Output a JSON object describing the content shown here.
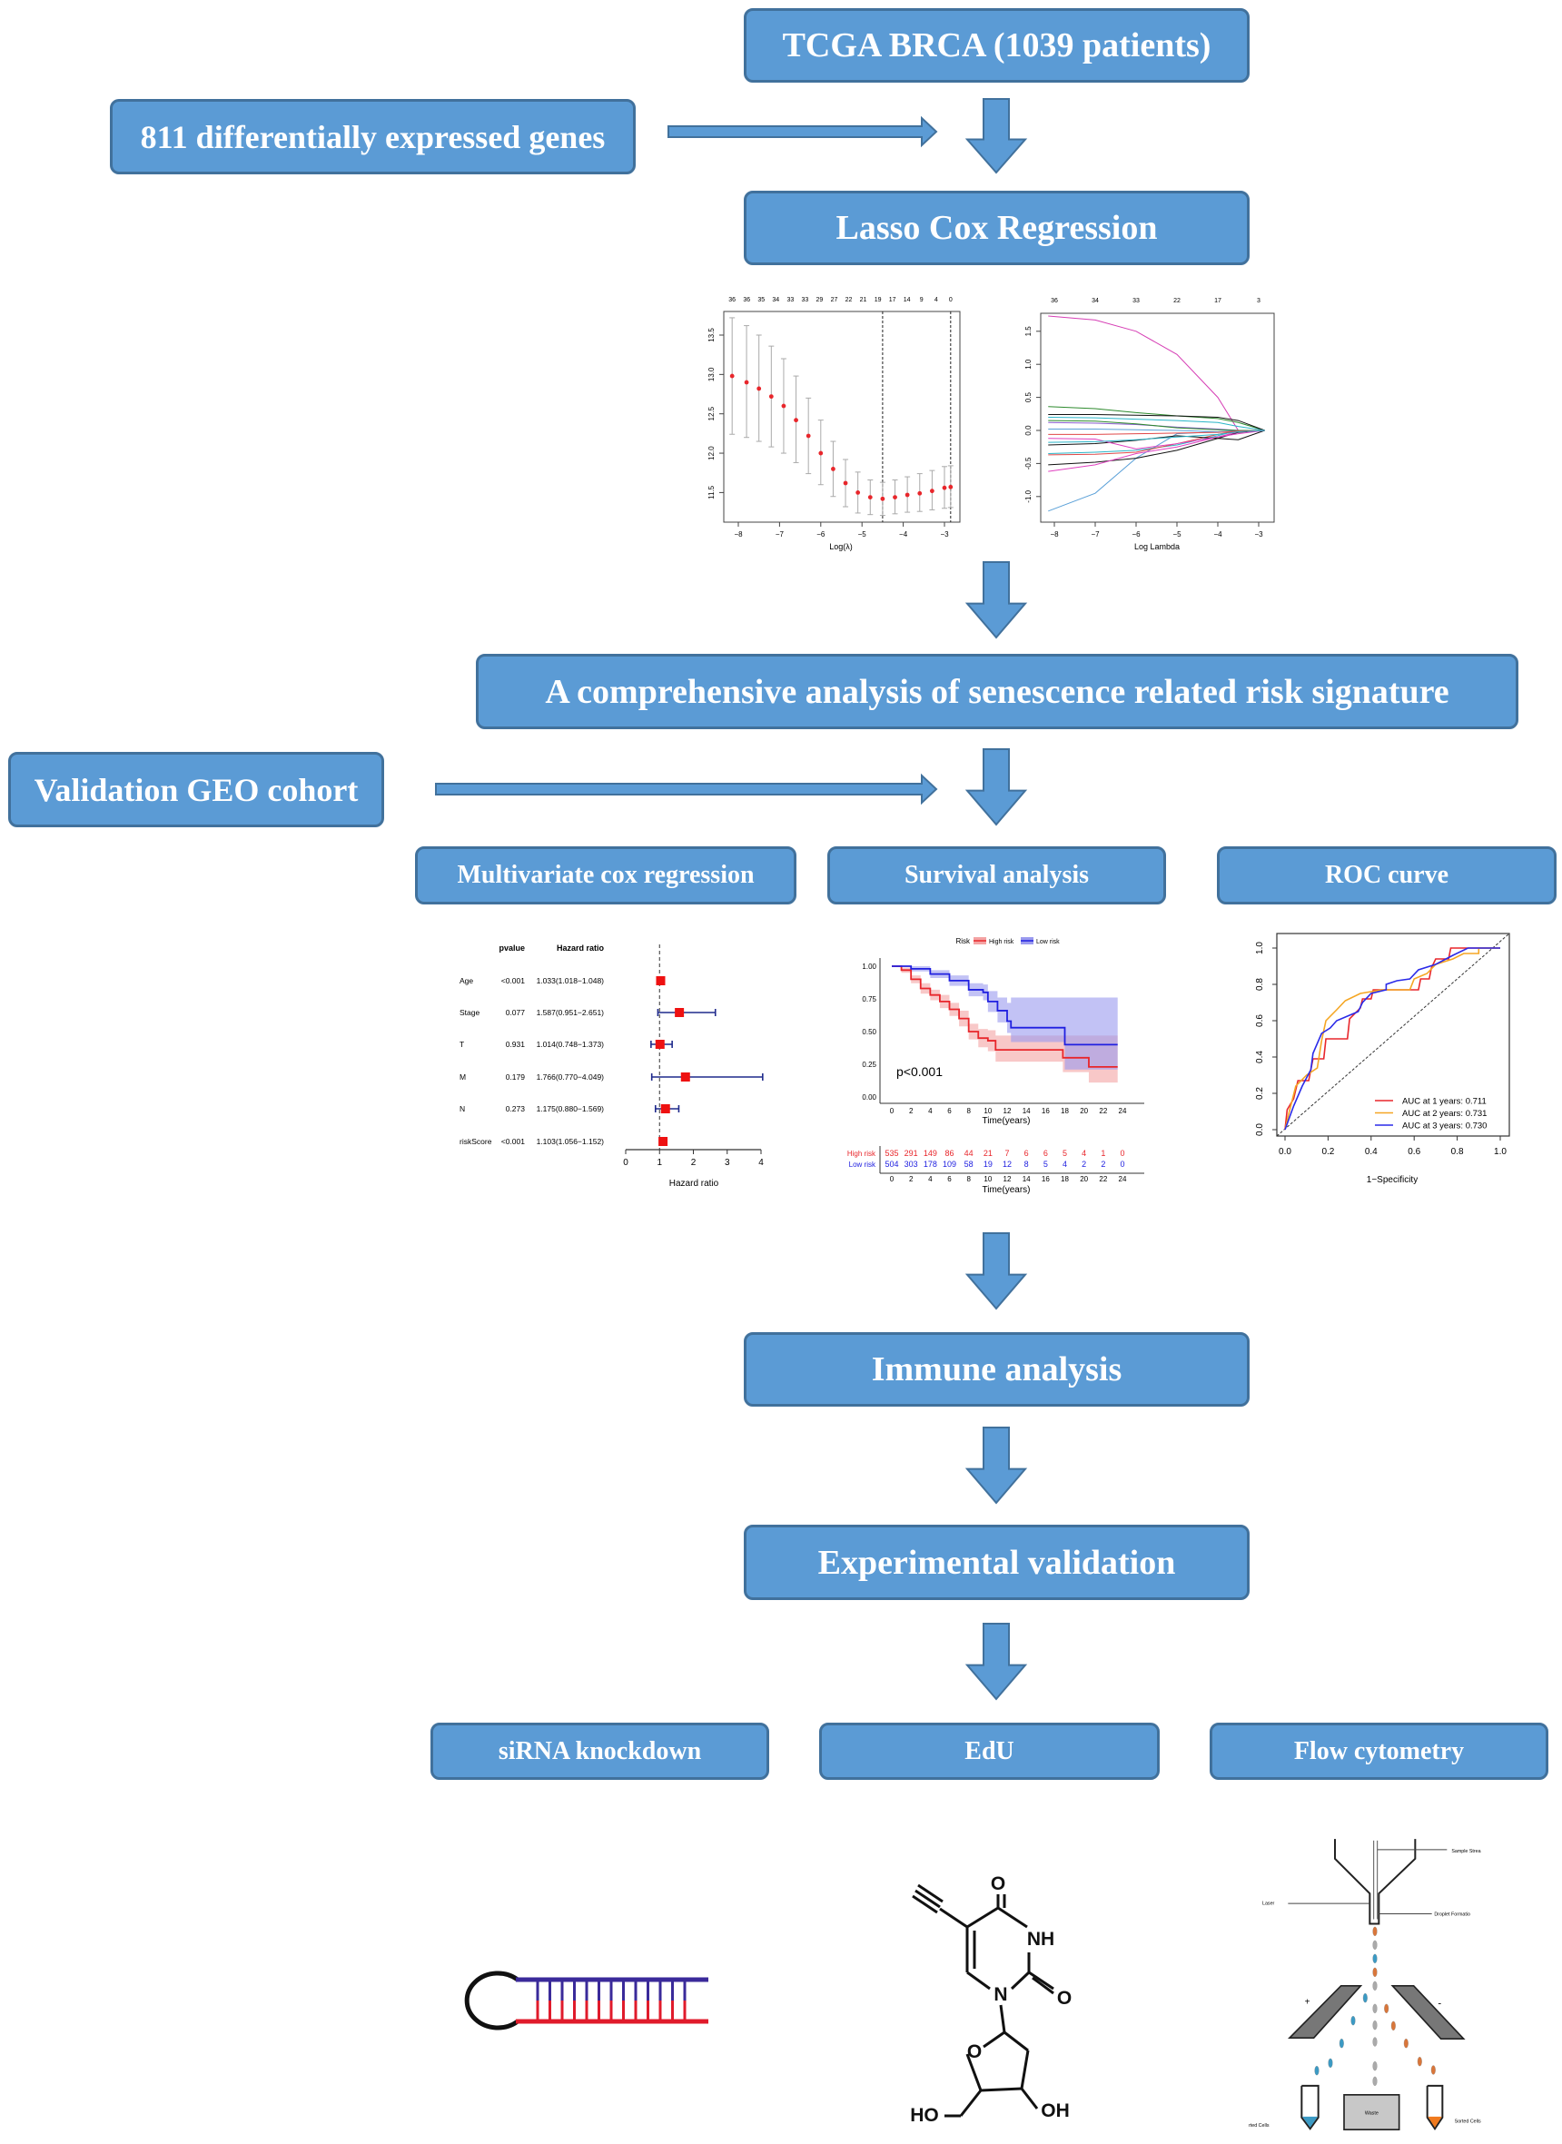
{
  "colors": {
    "box_fill": "#5b9bd5",
    "box_border": "#41719c",
    "high_risk": "#e8262b",
    "low_risk": "#2020e0"
  },
  "boxes": {
    "tcga": "TCGA BRCA (1039 patients)",
    "degs": "811 differentially expressed genes",
    "lasso": "Lasso Cox Regression",
    "comprehensive": "A comprehensive analysis of senescence related risk signature",
    "validation": "Validation GEO cohort",
    "multivariate": "Multivariate cox regression",
    "survival": "Survival analysis",
    "roc": "ROC curve",
    "immune": "Immune analysis",
    "experimental": "Experimental validation",
    "sirna": "siRNA knockdown",
    "edu": "EdU",
    "flow": "Flow cytometry"
  },
  "chart_data": [
    {
      "id": "lasso_cv",
      "type": "scatter",
      "xlabel": "Log(λ)",
      "ylabel": "",
      "xticks": [
        -8,
        -7,
        -6,
        -5,
        -4,
        -3
      ],
      "yticks": [
        "11.5",
        "12.0",
        "12.5",
        "13.0",
        "13.5"
      ],
      "ylim": [
        11.12,
        13.8
      ],
      "top_labels": [
        "36",
        "36",
        "35",
        "34",
        "33",
        "33",
        "29",
        "27",
        "22",
        "21",
        "19",
        "17",
        "14",
        "9",
        "4",
        "0"
      ],
      "vlines": [
        -4.5,
        -2.85
      ],
      "points": [
        [
          -8.15,
          12.98,
          12.24,
          13.72
        ],
        [
          -7.8,
          12.9,
          12.2,
          13.62
        ],
        [
          -7.5,
          12.82,
          12.15,
          13.5
        ],
        [
          -7.2,
          12.72,
          12.08,
          13.36
        ],
        [
          -6.9,
          12.6,
          12.0,
          13.2
        ],
        [
          -6.6,
          12.42,
          11.88,
          12.98
        ],
        [
          -6.3,
          12.22,
          11.74,
          12.7
        ],
        [
          -6.0,
          12.0,
          11.6,
          12.42
        ],
        [
          -5.7,
          11.8,
          11.45,
          12.15
        ],
        [
          -5.4,
          11.62,
          11.32,
          11.92
        ],
        [
          -5.1,
          11.5,
          11.24,
          11.76
        ],
        [
          -4.8,
          11.44,
          11.22,
          11.66
        ],
        [
          -4.5,
          11.42,
          11.21,
          11.63
        ],
        [
          -4.2,
          11.44,
          11.23,
          11.66
        ],
        [
          -3.9,
          11.47,
          11.25,
          11.7
        ],
        [
          -3.6,
          11.49,
          11.26,
          11.74
        ],
        [
          -3.3,
          11.52,
          11.28,
          11.78
        ],
        [
          -3.0,
          11.56,
          11.3,
          11.83
        ],
        [
          -2.85,
          11.57,
          11.31,
          11.84
        ]
      ]
    },
    {
      "id": "lasso_path",
      "type": "line",
      "xlabel": "Log Lambda",
      "ylabel": "",
      "xticks": [
        -8,
        -7,
        -6,
        -5,
        -4,
        -3
      ],
      "yticks": [
        "-1.0",
        "-0.5",
        "0.0",
        "0.5",
        "1.0",
        "1.5"
      ],
      "top_labels": [
        "36",
        "34",
        "33",
        "22",
        "17",
        "3"
      ],
      "x": [
        -8.15,
        -7,
        -6,
        -5,
        -4,
        -3.5,
        -2.85
      ],
      "series": [
        {
          "color": "#d63fb5",
          "values": [
            1.73,
            1.67,
            1.5,
            1.15,
            0.5,
            0,
            0
          ]
        },
        {
          "color": "#5aa0d8",
          "values": [
            -1.22,
            -0.95,
            -0.42,
            -0.05,
            -0.02,
            0,
            0
          ]
        },
        {
          "color": "#2d8a2d",
          "values": [
            0.36,
            0.33,
            0.27,
            0.22,
            0.18,
            0.12,
            0
          ]
        },
        {
          "color": "#111111",
          "values": [
            0.24,
            0.24,
            0.23,
            0.22,
            0.2,
            0.15,
            0
          ]
        },
        {
          "color": "#111111",
          "values": [
            -0.52,
            -0.48,
            -0.42,
            -0.3,
            -0.12,
            -0.03,
            0
          ]
        },
        {
          "color": "#e040c0",
          "values": [
            -0.62,
            -0.52,
            -0.35,
            -0.25,
            -0.1,
            -0.02,
            0
          ]
        },
        {
          "color": "#2ab5c8",
          "values": [
            -0.35,
            -0.33,
            -0.3,
            -0.22,
            -0.08,
            0,
            0
          ]
        },
        {
          "color": "#e04848",
          "values": [
            -0.37,
            -0.36,
            -0.33,
            -0.2,
            -0.06,
            0,
            0
          ]
        },
        {
          "color": "#2ab5c8",
          "values": [
            0.2,
            0.19,
            0.17,
            0.15,
            0.12,
            0.06,
            0
          ]
        },
        {
          "color": "#8a5cd0",
          "values": [
            0.12,
            0.11,
            0.09,
            0.05,
            0.02,
            0,
            0
          ]
        },
        {
          "color": "#111111",
          "values": [
            -0.22,
            -0.2,
            -0.15,
            -0.08,
            -0.12,
            -0.14,
            0
          ]
        },
        {
          "color": "#2d8a2d",
          "values": [
            0.15,
            0.14,
            0.1,
            0.04,
            0.01,
            0,
            0
          ]
        },
        {
          "color": "#e040c0",
          "values": [
            -0.12,
            -0.13,
            -0.28,
            -0.2,
            -0.1,
            -0.05,
            0
          ]
        },
        {
          "color": "#5aa0d8",
          "values": [
            0.02,
            0.02,
            0.01,
            0.0,
            -0.02,
            -0.01,
            0
          ]
        },
        {
          "color": "#e04848",
          "values": [
            -0.06,
            -0.06,
            -0.05,
            -0.04,
            -0.03,
            -0.01,
            0
          ]
        },
        {
          "color": "#2ab5c8",
          "values": [
            -0.18,
            -0.17,
            -0.14,
            -0.1,
            -0.06,
            -0.02,
            0
          ]
        }
      ]
    },
    {
      "id": "forest",
      "type": "scatter",
      "xlabel": "Hazard ratio",
      "xticks": [
        0,
        1,
        2,
        3,
        4
      ],
      "ref_line": 1,
      "col_headers": {
        "pvalue": "pvalue",
        "hr": "Hazard ratio"
      },
      "rows": [
        {
          "label": "Age",
          "pvalue": "<0.001",
          "text": "1.033(1.018−1.048)",
          "hr": 1.033,
          "lo": 1.018,
          "hi": 1.048
        },
        {
          "label": "Stage",
          "pvalue": "0.077",
          "text": "1.587(0.951−2.651)",
          "hr": 1.587,
          "lo": 0.951,
          "hi": 2.651
        },
        {
          "label": "T",
          "pvalue": "0.931",
          "text": "1.014(0.748−1.373)",
          "hr": 1.014,
          "lo": 0.748,
          "hi": 1.373
        },
        {
          "label": "M",
          "pvalue": "0.179",
          "text": "1.766(0.770−4.049)",
          "hr": 1.766,
          "lo": 0.77,
          "hi": 4.049
        },
        {
          "label": "N",
          "pvalue": "0.273",
          "text": "1.175(0.880−1.569)",
          "hr": 1.175,
          "lo": 0.88,
          "hi": 1.569
        },
        {
          "label": "riskScore",
          "pvalue": "<0.001",
          "text": "1.103(1.056−1.152)",
          "hr": 1.103,
          "lo": 1.056,
          "hi": 1.152
        }
      ]
    },
    {
      "id": "km",
      "type": "line",
      "xlabel": "Time(years)",
      "legend_title": "Risk",
      "pvalue": "p<0.001",
      "xticks": [
        0,
        2,
        4,
        6,
        8,
        10,
        12,
        14,
        16,
        18,
        20,
        22,
        24
      ],
      "yticks": [
        "0.00",
        "0.25",
        "0.50",
        "0.75",
        "1.00"
      ],
      "series": [
        {
          "name": "High risk",
          "color": "#e8262b",
          "band": "#f4a3a3",
          "steps": [
            [
              0,
              1
            ],
            [
              1,
              0.97
            ],
            [
              2,
              0.9
            ],
            [
              3,
              0.83
            ],
            [
              4,
              0.78
            ],
            [
              5,
              0.73
            ],
            [
              6,
              0.67
            ],
            [
              7,
              0.6
            ],
            [
              8,
              0.5
            ],
            [
              9,
              0.45
            ],
            [
              10,
              0.43
            ],
            [
              10.8,
              0.36
            ],
            [
              17.8,
              0.3
            ],
            [
              20.5,
              0.23
            ],
            [
              23.5,
              0.23
            ]
          ],
          "lower": [
            1,
            0.95,
            0.87,
            0.79,
            0.74,
            0.68,
            0.62,
            0.54,
            0.44,
            0.38,
            0.35,
            0.27,
            0.19,
            0.11,
            0.11
          ],
          "upper": [
            1,
            0.99,
            0.93,
            0.87,
            0.82,
            0.78,
            0.72,
            0.66,
            0.56,
            0.52,
            0.51,
            0.47,
            0.47,
            0.47,
            0.47
          ]
        },
        {
          "name": "Low risk",
          "color": "#2020e0",
          "band": "#9a9aef",
          "steps": [
            [
              0,
              1
            ],
            [
              2,
              0.98
            ],
            [
              4,
              0.94
            ],
            [
              6,
              0.89
            ],
            [
              8,
              0.82
            ],
            [
              9.5,
              0.8
            ],
            [
              10,
              0.73
            ],
            [
              11,
              0.66
            ],
            [
              12,
              0.58
            ],
            [
              12.4,
              0.53
            ],
            [
              18,
              0.4
            ],
            [
              23.5,
              0.4
            ]
          ],
          "lower": [
            1,
            0.96,
            0.91,
            0.85,
            0.77,
            0.74,
            0.65,
            0.57,
            0.49,
            0.42,
            0.21,
            0.21
          ],
          "upper": [
            1,
            1,
            0.97,
            0.93,
            0.87,
            0.86,
            0.81,
            0.76,
            0.72,
            0.76,
            0.76,
            0.76
          ]
        }
      ],
      "risk_table": {
        "times": [
          0,
          2,
          4,
          6,
          8,
          10,
          12,
          14,
          16,
          18,
          20,
          22,
          24
        ],
        "rows": [
          {
            "name": "High risk",
            "counts": [
              535,
              291,
              149,
              86,
              44,
              21,
              7,
              6,
              6,
              5,
              4,
              1,
              0
            ]
          },
          {
            "name": "Low risk",
            "counts": [
              504,
              303,
              178,
              109,
              58,
              19,
              12,
              8,
              5,
              4,
              2,
              2,
              0
            ]
          }
        ]
      }
    },
    {
      "id": "roc",
      "type": "line",
      "xlabel": "1−Specificity",
      "xticks": [
        "0.0",
        "0.2",
        "0.4",
        "0.6",
        "0.8",
        "1.0"
      ],
      "yticks": [
        "0.0",
        "0.2",
        "0.4",
        "0.6",
        "0.8",
        "1.0"
      ],
      "legend_position": "bottom-right",
      "series": [
        {
          "name": "AUC at 1 years: 0.711",
          "color": "#e8262b",
          "points": [
            [
              0,
              0
            ],
            [
              0.01,
              0.11
            ],
            [
              0.04,
              0.17
            ],
            [
              0.06,
              0.27
            ],
            [
              0.11,
              0.27
            ],
            [
              0.13,
              0.39
            ],
            [
              0.18,
              0.39
            ],
            [
              0.19,
              0.5
            ],
            [
              0.29,
              0.5
            ],
            [
              0.3,
              0.61
            ],
            [
              0.35,
              0.67
            ],
            [
              0.36,
              0.72
            ],
            [
              0.4,
              0.72
            ],
            [
              0.41,
              0.77
            ],
            [
              0.62,
              0.77
            ],
            [
              0.63,
              0.83
            ],
            [
              0.67,
              0.83
            ],
            [
              0.68,
              0.89
            ],
            [
              0.7,
              0.94
            ],
            [
              0.76,
              0.94
            ],
            [
              0.77,
              1
            ],
            [
              1,
              1
            ]
          ]
        },
        {
          "name": "AUC at 2 years: 0.731",
          "color": "#f5a623",
          "points": [
            [
              0,
              0
            ],
            [
              0.02,
              0.1
            ],
            [
              0.05,
              0.24
            ],
            [
              0.1,
              0.3
            ],
            [
              0.15,
              0.34
            ],
            [
              0.17,
              0.49
            ],
            [
              0.19,
              0.6
            ],
            [
              0.24,
              0.66
            ],
            [
              0.28,
              0.71
            ],
            [
              0.35,
              0.75
            ],
            [
              0.45,
              0.77
            ],
            [
              0.58,
              0.77
            ],
            [
              0.6,
              0.83
            ],
            [
              0.66,
              0.86
            ],
            [
              0.7,
              0.91
            ],
            [
              0.78,
              0.94
            ],
            [
              0.83,
              0.97
            ],
            [
              0.9,
              0.97
            ],
            [
              0.9,
              1
            ],
            [
              1,
              1
            ]
          ]
        },
        {
          "name": "AUC at 3 years: 0.730",
          "color": "#2a2ae8",
          "points": [
            [
              0,
              0
            ],
            [
              0.04,
              0.13
            ],
            [
              0.08,
              0.24
            ],
            [
              0.12,
              0.33
            ],
            [
              0.13,
              0.42
            ],
            [
              0.17,
              0.53
            ],
            [
              0.21,
              0.56
            ],
            [
              0.24,
              0.6
            ],
            [
              0.3,
              0.63
            ],
            [
              0.34,
              0.65
            ],
            [
              0.36,
              0.7
            ],
            [
              0.4,
              0.75
            ],
            [
              0.47,
              0.77
            ],
            [
              0.47,
              0.8
            ],
            [
              0.52,
              0.82
            ],
            [
              0.58,
              0.83
            ],
            [
              0.62,
              0.88
            ],
            [
              0.7,
              0.91
            ],
            [
              0.78,
              0.96
            ],
            [
              0.85,
              1
            ],
            [
              1,
              1
            ]
          ]
        }
      ]
    }
  ],
  "flow_diagram": {
    "sample_stream": "Sample Strea",
    "laser": "Laser",
    "droplet": "Droplet Formatio",
    "waste": "Waste",
    "sorted_right": "Sorted Cells",
    "sorted_left": "rted Cells",
    "plus": "+",
    "minus": "-"
  },
  "edu_structure": {
    "o_top": "O",
    "nh": "NH",
    "n": "N",
    "o_right": "O",
    "ho": "HO",
    "oh": "OH",
    "o_ring": "O"
  }
}
